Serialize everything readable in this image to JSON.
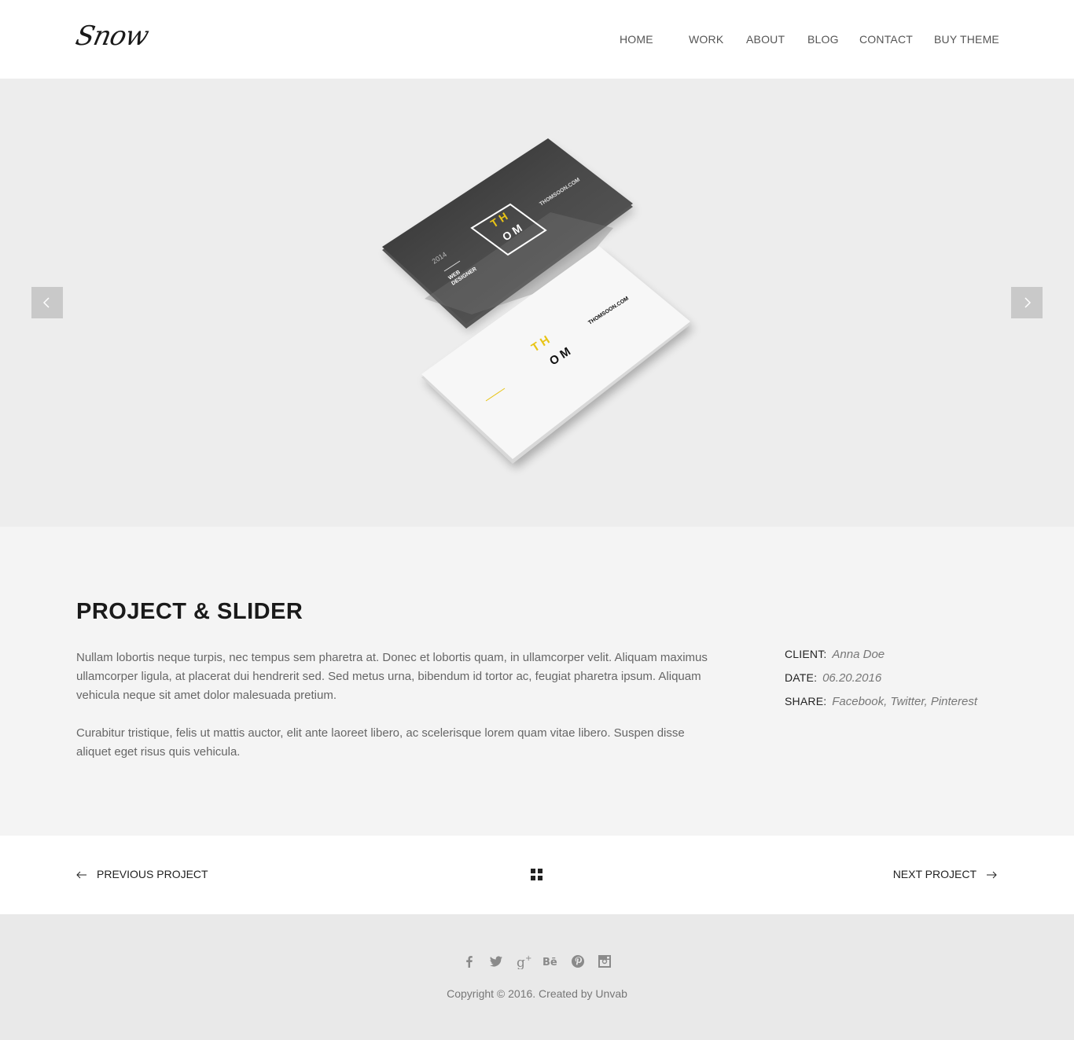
{
  "header": {
    "logo": "Snow",
    "nav": [
      {
        "label": "HOME"
      },
      {
        "label": "WORK"
      },
      {
        "label": "ABOUT"
      },
      {
        "label": "BLOG"
      },
      {
        "label": "CONTACT"
      },
      {
        "label": "BUY THEME"
      }
    ]
  },
  "slider": {
    "image_alt": "Business card mockup",
    "card_dark": {
      "year": "2014",
      "role_line1": "WEB",
      "role_line2": "DESIGNER",
      "site": "THOMSOON.COM"
    },
    "card_light": {
      "site": "THOMSOON.COM"
    },
    "monogram": {
      "top": "T H",
      "bottom": "O M"
    },
    "accent_color": "#e8c416",
    "prev_icon": "chevron-left-icon",
    "next_icon": "chevron-right-icon"
  },
  "project": {
    "title": "PROJECT & SLIDER",
    "paragraphs": [
      "Nullam lobortis neque turpis, nec tempus sem pharetra at. Donec et lobortis quam, in ullamcorper velit. Aliquam maximus ullamcorper ligula, at placerat dui hendrerit sed. Sed metus urna, bibendum id tortor ac, feugiat pharetra ipsum. Aliquam vehicula neque sit amet dolor malesuada pretium.",
      "Curabitur tristique, felis ut mattis auctor, elit ante laoreet libero, ac scelerisque lorem quam vitae libero. Suspen disse aliquet eget risus quis vehicula."
    ],
    "meta": [
      {
        "label": "CLIENT:",
        "value": "Anna Doe"
      },
      {
        "label": "DATE:",
        "value": "06.20.2016"
      },
      {
        "label": "SHARE:",
        "value": "Facebook, Twitter, Pinterest"
      }
    ]
  },
  "project_nav": {
    "previous_label": "PREVIOUS PROJECT",
    "next_label": "NEXT PROJECT",
    "grid_icon": "grid-icon"
  },
  "footer": {
    "socials": [
      "facebook",
      "twitter",
      "google-plus",
      "behance",
      "pinterest",
      "instagram"
    ],
    "copyright": "Copyright © 2016. Created by Unvab"
  }
}
